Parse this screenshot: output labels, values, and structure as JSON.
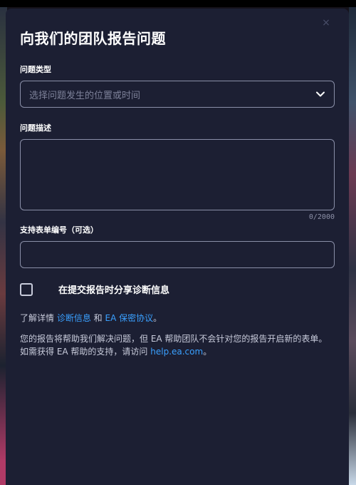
{
  "modal": {
    "title": "向我们的团队报告问题",
    "close_symbol": "×",
    "issue_type": {
      "label": "问题类型",
      "placeholder": "选择问题发生的位置或时间"
    },
    "description": {
      "label": "问题描述",
      "char_count": "0/2000"
    },
    "ticket": {
      "label": "支持表单编号（可选）"
    },
    "share_diagnostics": {
      "label": "在提交报告时分享诊断信息"
    },
    "learn_more": {
      "prefix": "了解详情 ",
      "link1": "诊断信息",
      "middle": " 和 ",
      "link2": "EA 保密协议",
      "suffix": "。"
    },
    "note": {
      "text": "您的报告将帮助我们解决问题，但 EA 帮助团队不会针对您的报告开启新的表单。 如需获得 EA 帮助的支持，请访问 ",
      "link": "help.ea.com",
      "suffix": "。"
    }
  },
  "colors": {
    "modal_bg": "#1c1f33",
    "link": "#3aa0ff",
    "border": "#8a8fa8"
  }
}
